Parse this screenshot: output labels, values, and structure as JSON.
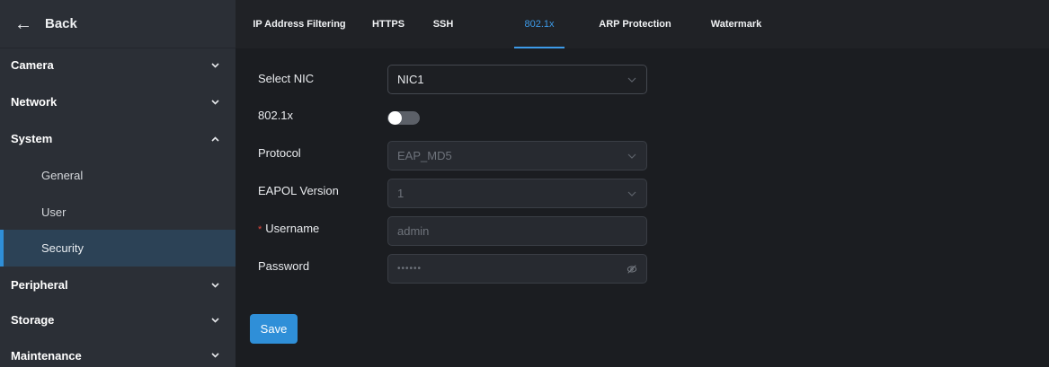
{
  "sidebar": {
    "back_label": "Back",
    "items": [
      {
        "label": "Camera"
      },
      {
        "label": "Network"
      },
      {
        "label": "System"
      },
      {
        "label": "Peripheral"
      },
      {
        "label": "Storage"
      },
      {
        "label": "Maintenance"
      }
    ],
    "system_sub": [
      {
        "label": "General"
      },
      {
        "label": "User"
      },
      {
        "label": "Security",
        "active": true
      }
    ]
  },
  "tabs": [
    {
      "label": "IP Address Filtering"
    },
    {
      "label": "HTTPS"
    },
    {
      "label": "SSH"
    },
    {
      "label": "802.1x",
      "active": true
    },
    {
      "label": "ARP Protection"
    },
    {
      "label": "Watermark"
    }
  ],
  "form": {
    "select_nic": {
      "label": "Select NIC",
      "value": "NIC1"
    },
    "enable_8021x": {
      "label": "802.1x",
      "enabled": false
    },
    "protocol": {
      "label": "Protocol",
      "value": "EAP_MD5"
    },
    "eapol_version": {
      "label": "EAPOL Version",
      "value": "1"
    },
    "username": {
      "label": "Username",
      "required_mark": "*",
      "placeholder": "admin"
    },
    "password": {
      "label": "Password",
      "value": "••••••"
    },
    "save_label": "Save"
  },
  "colors": {
    "accent": "#2f8fd8",
    "active_tab": "#3d9be9",
    "required": "#e0483e"
  }
}
